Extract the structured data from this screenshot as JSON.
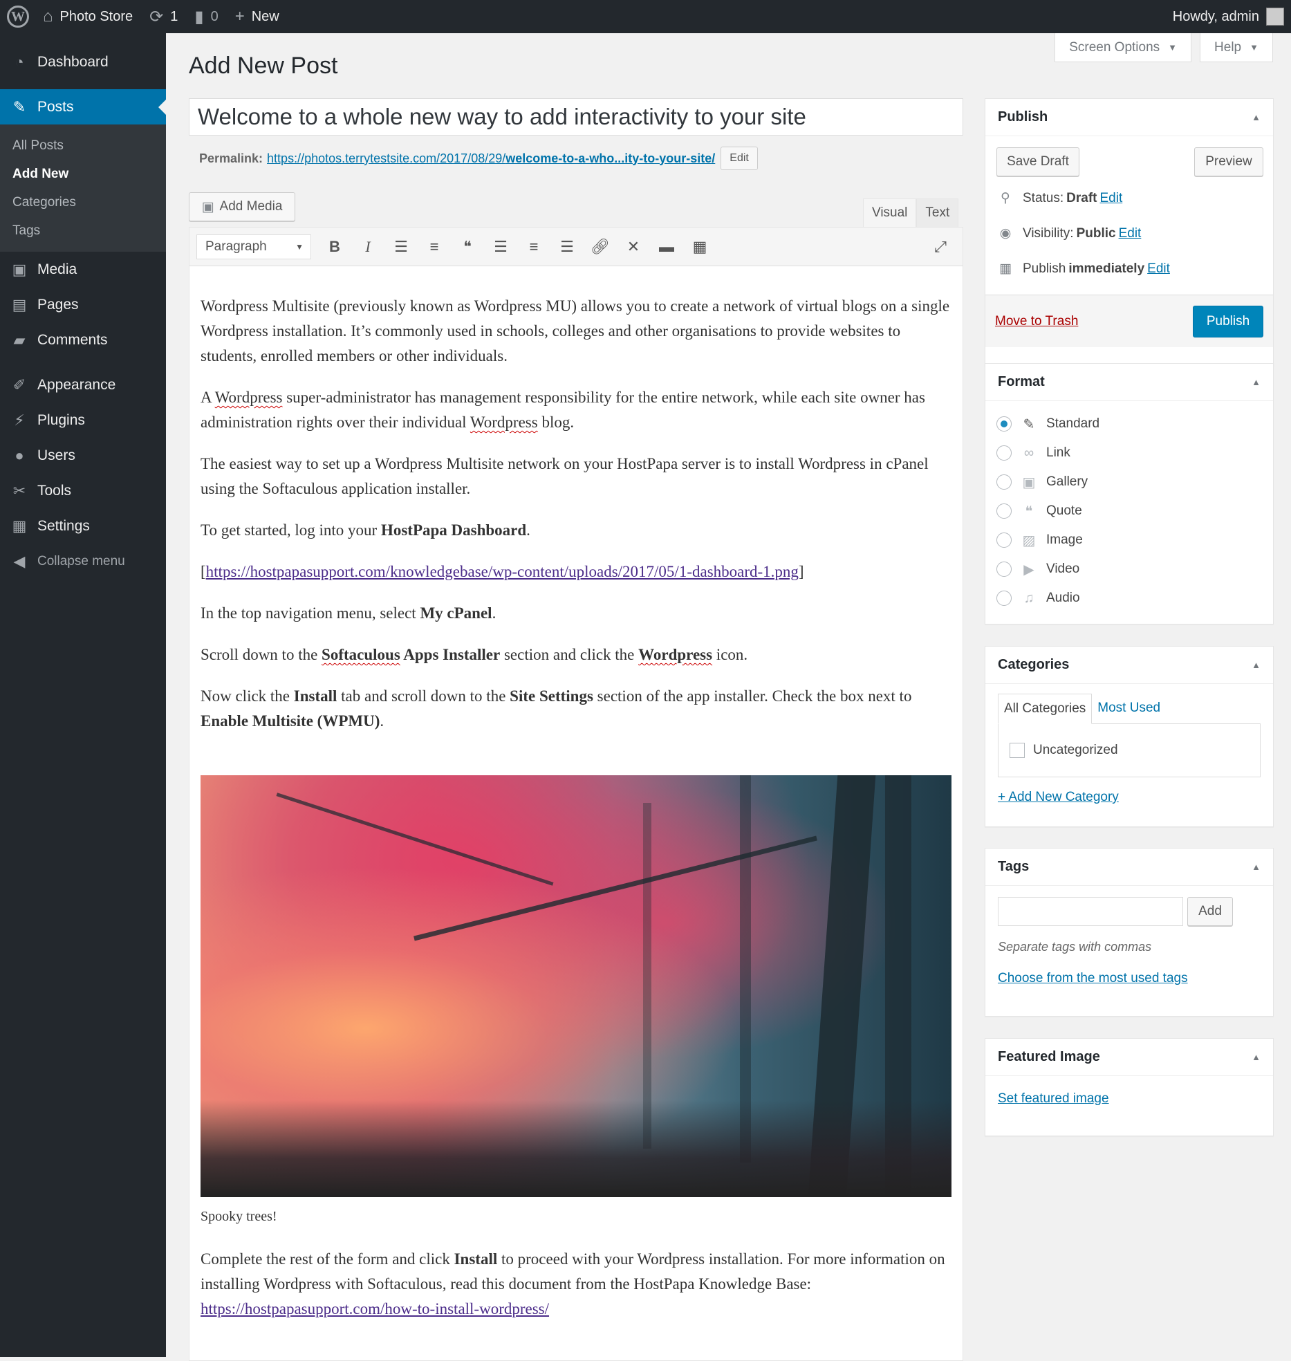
{
  "adminbar": {
    "site_name": "Photo Store",
    "updates_count": "1",
    "comments_count": "0",
    "new_label": "New",
    "howdy": "Howdy, admin"
  },
  "menu": {
    "dashboard": "Dashboard",
    "posts": "Posts",
    "posts_sub": [
      "All Posts",
      "Add New",
      "Categories",
      "Tags"
    ],
    "media": "Media",
    "pages": "Pages",
    "comments": "Comments",
    "appearance": "Appearance",
    "plugins": "Plugins",
    "users": "Users",
    "tools": "Tools",
    "settings": "Settings",
    "collapse": "Collapse menu"
  },
  "screen_meta": {
    "screen_options": "Screen Options",
    "help": "Help"
  },
  "page": {
    "title": "Add New Post",
    "post_title": "Welcome to a whole new way to add interactivity to your site",
    "permalink_label": "Permalink:",
    "permalink_base": "https://photos.terrytestsite.com/2017/08/29/",
    "permalink_slug": "welcome-to-a-who...ity-to-your-site/",
    "permalink_edit": "Edit",
    "add_media": "Add Media",
    "tab_visual": "Visual",
    "tab_text": "Text",
    "format_select": "Paragraph"
  },
  "content": {
    "p1": "Wordpress Multisite (previously known as Wordpress MU) allows you to create a network of virtual blogs on a single Wordpress installation. It’s commonly used in schools, colleges and other organisations to provide websites to students, enrolled members or other individuals.",
    "p2_a": "A ",
    "p2_wp1": "Wordpress",
    "p2_b": " super-administrator has management responsibility for the entire network, while each site owner has administration rights over their individual ",
    "p2_wp2": "Wordpress",
    "p2_c": " blog.",
    "p3": "The easiest way to set up a Wordpress Multisite network on your HostPapa server is to install Wordpress in cPanel using the Softaculous application installer.",
    "p4_a": "To get started, log into your ",
    "p4_b": "HostPapa Dashboard",
    "p4_c": ".",
    "p5_open": "[",
    "p5_link": "https://hostpapasupport.com/knowledgebase/wp-content/uploads/2017/05/1-dashboard-1.png",
    "p5_close": "]",
    "p6_a": "In the top navigation menu, select ",
    "p6_b": "My cPanel",
    "p6_c": ".",
    "p7_a": "Scroll down to the ",
    "p7_b": "Softaculous",
    "p7_c": " Apps Installer",
    "p7_d": " section and click the ",
    "p7_e": "Wordpress",
    "p7_f": " icon.",
    "p8_a": "Now click the ",
    "p8_b": "Install",
    "p8_c": " tab and scroll down to the ",
    "p8_d": "Site Settings",
    "p8_e": " section of the app installer. Check the box next to ",
    "p8_f": "Enable Multisite (WPMU)",
    "p8_g": ".",
    "caption": "Spooky trees!",
    "p9_a": "Complete the rest of the form and click ",
    "p9_b": "Install",
    "p9_c": " to proceed with your Wordpress installation. For more information on installing Wordpress with Softaculous, read this document from the HostPapa Knowledge Base: ",
    "p9_link": "https://hostpapasupport.com/how-to-install-wordpress/"
  },
  "publish": {
    "title": "Publish",
    "save_draft": "Save Draft",
    "preview": "Preview",
    "status_label": "Status:",
    "status_value": "Draft",
    "visibility_label": "Visibility:",
    "visibility_value": "Public",
    "publish_label": "Publish",
    "publish_value": "immediately",
    "edit": "Edit",
    "trash": "Move to Trash",
    "publish_button": "Publish"
  },
  "format": {
    "title": "Format",
    "options": [
      "Standard",
      "Link",
      "Gallery",
      "Quote",
      "Image",
      "Video",
      "Audio"
    ],
    "selected": "Standard"
  },
  "categories": {
    "title": "Categories",
    "tab_all": "All Categories",
    "tab_used": "Most Used",
    "items": [
      "Uncategorized"
    ],
    "add_new": "+ Add New Category"
  },
  "tags": {
    "title": "Tags",
    "add": "Add",
    "hint": "Separate tags with commas",
    "choose": "Choose from the most used tags"
  },
  "featured": {
    "title": "Featured Image",
    "set": "Set featured image"
  },
  "colors": {
    "admin_bg": "#23282d",
    "accent": "#0073aa",
    "publish": "#0085ba",
    "trash": "#a00"
  }
}
